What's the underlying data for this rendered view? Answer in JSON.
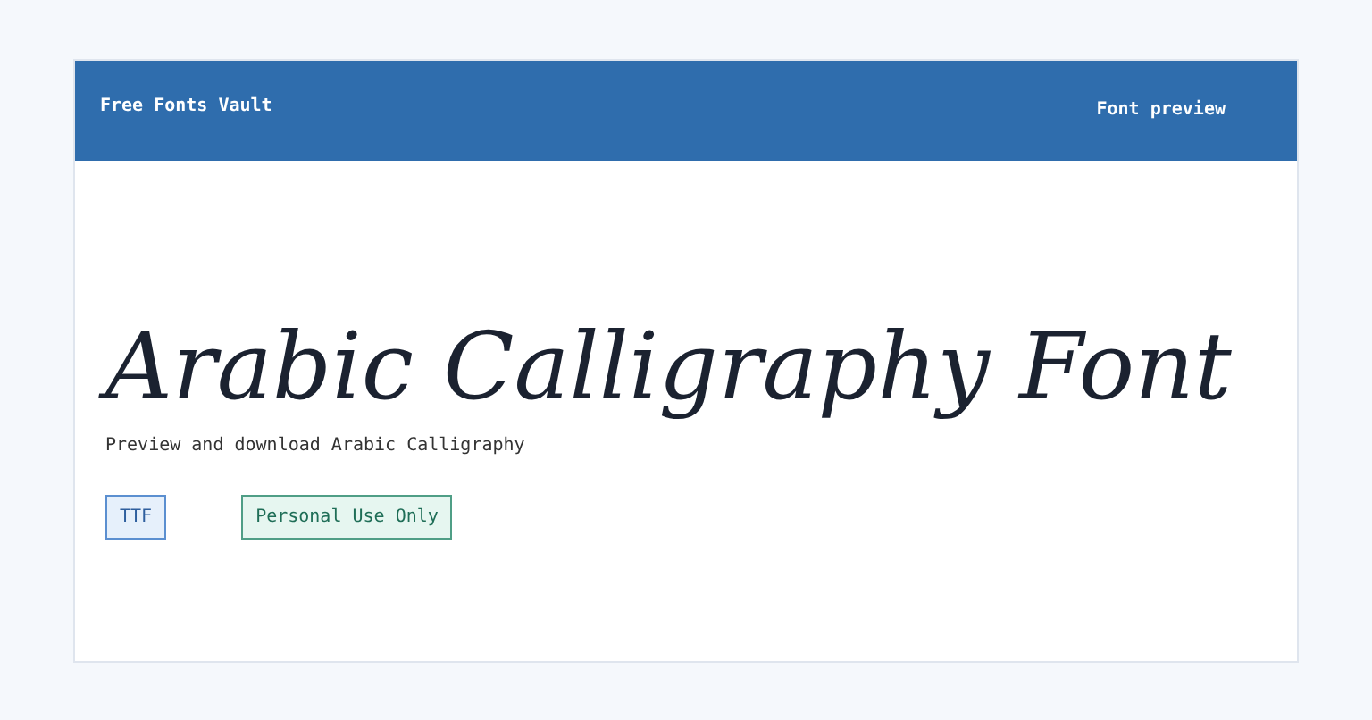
{
  "header": {
    "site_name": "Free Fonts Vault",
    "nav_link": "Font preview"
  },
  "preview": {
    "sample_text": "Arabic Calligraphy Font",
    "description": "Preview and download Arabic Calligraphy"
  },
  "tags": [
    {
      "label": "TTF",
      "kind": "format"
    },
    {
      "label": "Personal Use Only",
      "kind": "license"
    }
  ]
}
